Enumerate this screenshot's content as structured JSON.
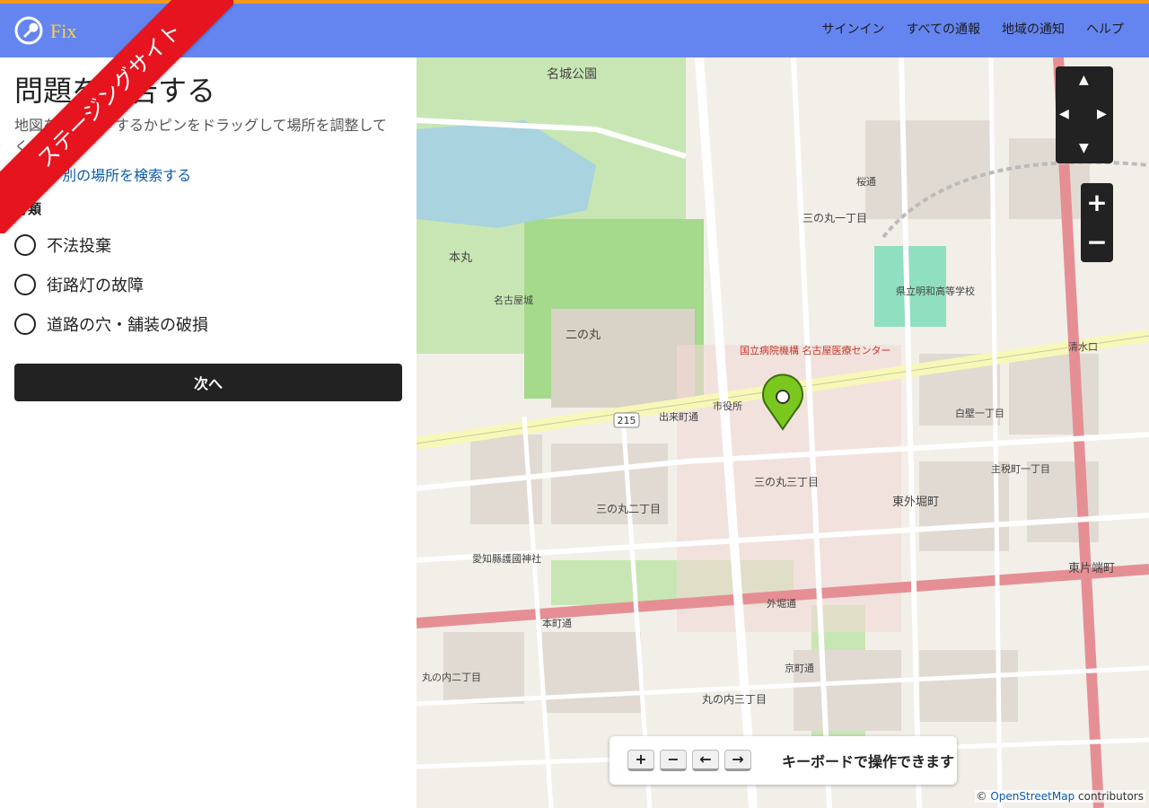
{
  "header": {
    "logo_text": "Fix",
    "ribbon": "ステージングサイト",
    "nav": [
      "サインイン",
      "すべての通報",
      "地域の通知",
      "ヘルプ"
    ]
  },
  "panel": {
    "title": "問題を報告する",
    "instruction": "地図をクリックするかピンをドラッグして場所を調整してください",
    "alt_prefix": "または",
    "alt_link": "別の場所を検索する",
    "category_label": "分類",
    "options": [
      "不法投棄",
      "街路灯の故障",
      "道路の穴・舗装の破損"
    ],
    "next_button": "次へ"
  },
  "map": {
    "keyboard_text": "キーボードで操作できます",
    "attribution_prefix": "©",
    "attribution_link": "OpenStreetMap",
    "attribution_suffix": "contributors",
    "labels": [
      "名城公園",
      "本丸",
      "二の丸",
      "名古屋城",
      "三の丸一丁目",
      "三の丸二丁目",
      "三の丸三丁目",
      "市役所",
      "出来町通",
      "東外堀町",
      "東片端町",
      "丸の内三丁目",
      "丸の内二丁目",
      "外堀通",
      "愛知縣護國神社",
      "国立病院機構 名古屋医療センター",
      "県立明和高等学校",
      "白壁一丁目",
      "主税町一丁目",
      "清水口",
      "京町通",
      "本町通",
      "桜通"
    ],
    "route_number": "215",
    "pin_color": "#7ac81e"
  }
}
